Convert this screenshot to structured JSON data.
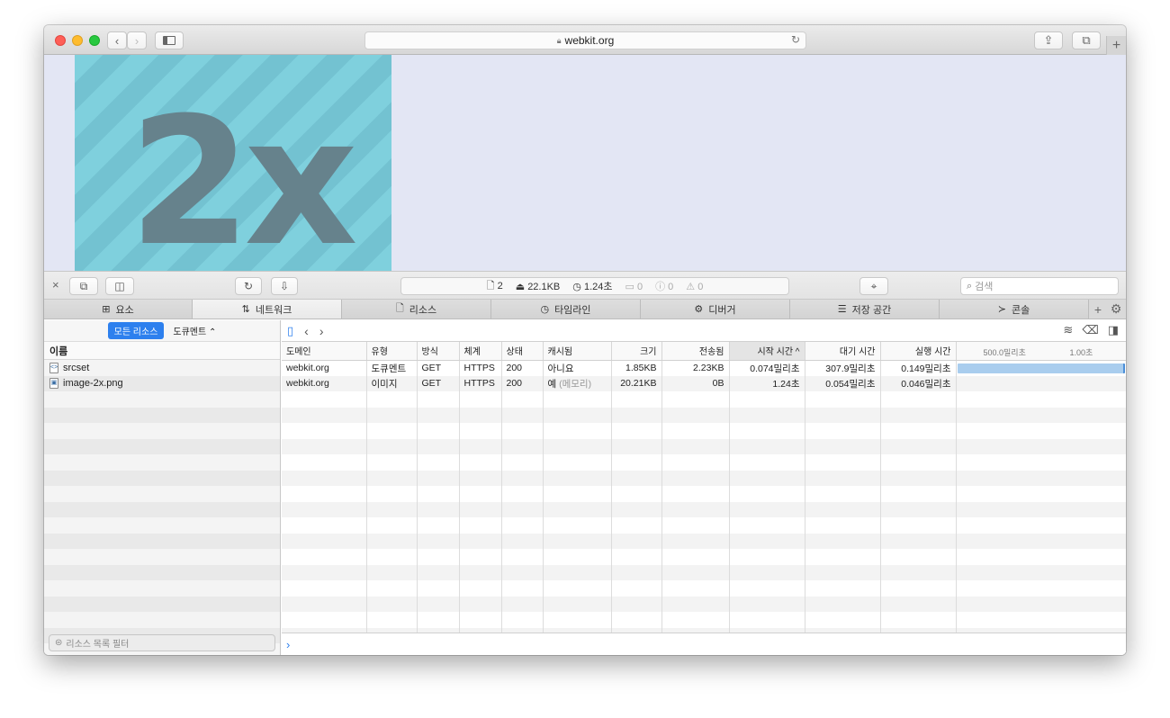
{
  "browser": {
    "url": "webkit.org",
    "colors": {
      "close": "#fe5f57",
      "minimize": "#febc2e",
      "zoom": "#28c840"
    }
  },
  "page": {
    "hero_text": "2x"
  },
  "devtools": {
    "dashboard": {
      "resources": "2",
      "size": "22.1KB",
      "time": "1.24초",
      "logs": "0",
      "errors": "0",
      "warnings": "0"
    },
    "search_placeholder": "검색",
    "tabs": [
      {
        "label": "요소",
        "icon": "elements-icon"
      },
      {
        "label": "네트워크",
        "icon": "network-icon"
      },
      {
        "label": "리소스",
        "icon": "resources-icon"
      },
      {
        "label": "타임라인",
        "icon": "timeline-icon"
      },
      {
        "label": "디버거",
        "icon": "debugger-icon"
      },
      {
        "label": "저장 공간",
        "icon": "storage-icon"
      },
      {
        "label": "콘솔",
        "icon": "console-icon"
      }
    ],
    "sidebar": {
      "all_resources": "모든 리소스",
      "document_select": "도큐멘트 ⌃",
      "name_header": "이름",
      "items": [
        "srcset",
        "image-2x.png"
      ],
      "filter_placeholder": "리소스 목록 필터"
    },
    "table": {
      "headers": [
        "도메인",
        "유형",
        "방식",
        "체계",
        "상태",
        "캐시됨",
        "크기",
        "전송됨",
        "시작 시간 ^",
        "대기 시간",
        "실행 시간"
      ],
      "waterfall_ticks": [
        "500.0밀리초",
        "1.00초"
      ],
      "rows": [
        {
          "domain": "webkit.org",
          "type": "도큐멘트",
          "method": "GET",
          "scheme": "HTTPS",
          "status": "200",
          "cached": "아니요",
          "cached_note": "",
          "size": "1.85KB",
          "transferred": "2.23KB",
          "start": "0.074밀리초",
          "latency": "307.9밀리초",
          "duration": "0.149밀리초",
          "bar_fraction": 1.0
        },
        {
          "domain": "webkit.org",
          "type": "이미지",
          "method": "GET",
          "scheme": "HTTPS",
          "status": "200",
          "cached": "예",
          "cached_note": "(메모리)",
          "size": "20.21KB",
          "transferred": "0B",
          "start": "1.24초",
          "latency": "0.054밀리초",
          "duration": "0.046밀리초",
          "bar_fraction": 0
        }
      ]
    },
    "console_prompt": "›"
  }
}
